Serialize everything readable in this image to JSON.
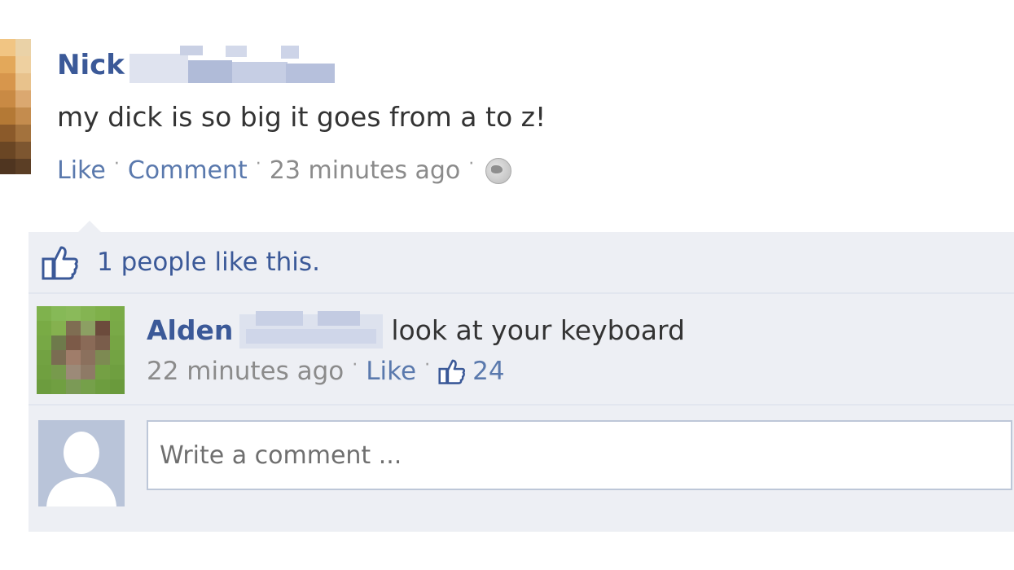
{
  "post": {
    "author": "Nick",
    "text": "my dick is so big it goes from a to z!",
    "actions": {
      "like": "Like",
      "comment": "Comment",
      "time": "23 minutes ago"
    }
  },
  "likes": {
    "summary": "1 people like this."
  },
  "comment": {
    "author": "Alden",
    "text": "look at your keyboard",
    "time": "22 minutes ago",
    "like": "Like",
    "like_count": "24"
  },
  "composer": {
    "placeholder": "Write a comment ..."
  },
  "colors": {
    "link_blue": "#3b5998",
    "ufi_bg": "#edeff4"
  },
  "icons": [
    "globe-icon",
    "thumbs-up-icon",
    "default-avatar-icon"
  ]
}
